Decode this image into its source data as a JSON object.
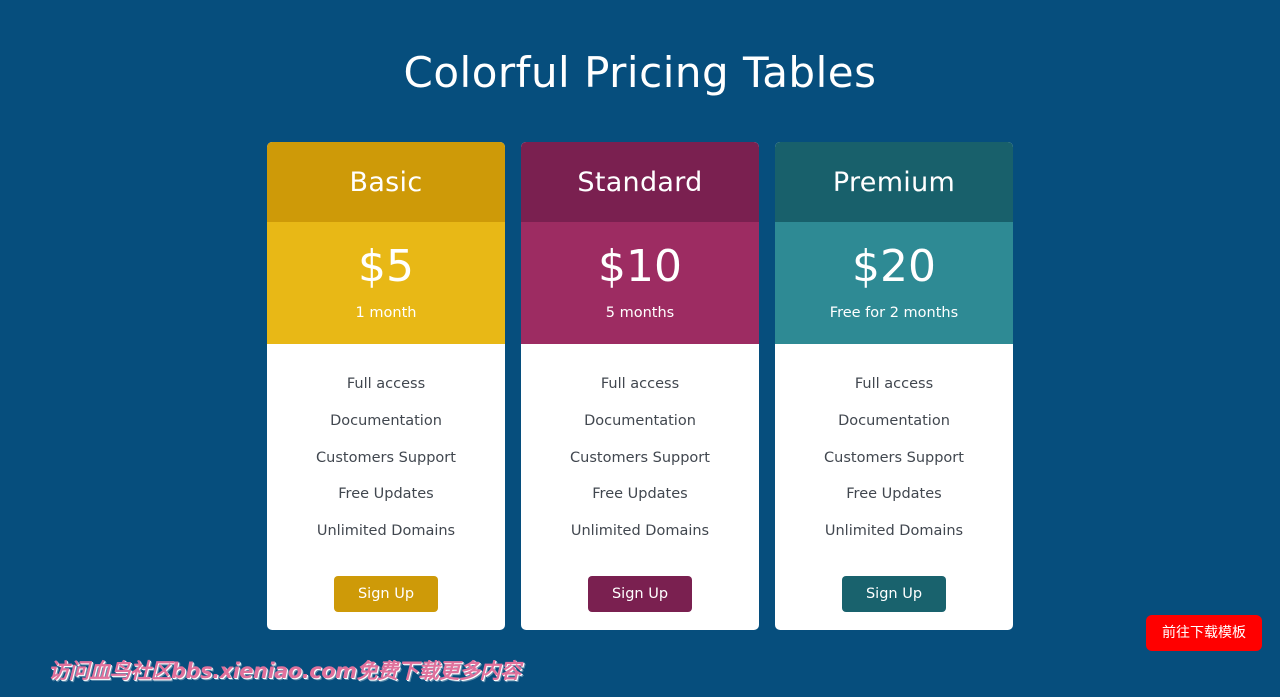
{
  "page": {
    "title": "Colorful Pricing Tables",
    "background_color": "#064E7D"
  },
  "plans": [
    {
      "name": "Basic",
      "price": "$5",
      "period": "1 month",
      "cta_label": "Sign Up",
      "header_color": "#CE9A08",
      "price_color": "#E8B816",
      "button_color": "#CE9A08",
      "features": [
        "Full access",
        "Documentation",
        "Customers Support",
        "Free Updates",
        "Unlimited Domains"
      ]
    },
    {
      "name": "Standard",
      "price": "$10",
      "period": "5 months",
      "cta_label": "Sign Up",
      "header_color": "#7A2050",
      "price_color": "#9D2C62",
      "button_color": "#7A2050",
      "features": [
        "Full access",
        "Documentation",
        "Customers Support",
        "Free Updates",
        "Unlimited Domains"
      ]
    },
    {
      "name": "Premium",
      "price": "$20",
      "period": "Free for 2 months",
      "cta_label": "Sign Up",
      "header_color": "#18606B",
      "price_color": "#2E8A94",
      "button_color": "#19626D",
      "features": [
        "Full access",
        "Documentation",
        "Customers Support",
        "Free Updates",
        "Unlimited Domains"
      ]
    }
  ],
  "watermark": {
    "text": "访问血鸟社区bbs.xieniao.com免费下载更多内容",
    "color": "#E0719C"
  },
  "download_fab": {
    "label": "前往下载模板",
    "color": "#FF0000"
  }
}
